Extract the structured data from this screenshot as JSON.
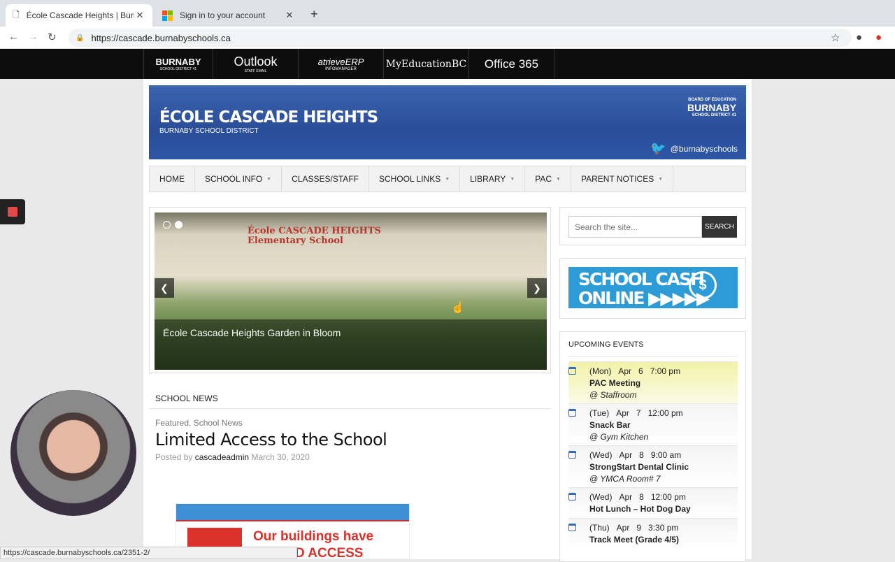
{
  "browser": {
    "tabs": [
      {
        "title": "École Cascade Heights | Burna",
        "active": true
      },
      {
        "title": "Sign in to your account",
        "active": false
      }
    ],
    "url": "https://cascade.burnabyschools.ca",
    "status_url": "https://cascade.burnabyschools.ca/2351-2/"
  },
  "toolbar": {
    "links": [
      {
        "label": "BURNABY",
        "sub": "SCHOOL DISTRICT 41"
      },
      {
        "label": "Outlook",
        "sub": "STAFF EMAIL"
      },
      {
        "label": "atrieveERP",
        "sub": "INFOMANAGER"
      },
      {
        "label": "MyEducationBC",
        "sub": ""
      },
      {
        "label": "Office 365",
        "sub": ""
      }
    ]
  },
  "banner": {
    "school": "ÉCOLE CASCADE HEIGHTS",
    "district": "BURNABY SCHOOL DISTRICT",
    "logo": "BURNABY",
    "logo_sub": "SCHOOL DISTRICT 41",
    "logo_top": "BOARD OF EDUCATION",
    "twitter": "@burnabyschools"
  },
  "nav": [
    "HOME",
    "SCHOOL INFO",
    "CLASSES/STAFF",
    "SCHOOL LINKS",
    "LIBRARY",
    "PAC",
    "PARENT NOTICES"
  ],
  "slider": {
    "caption": "École Cascade Heights Garden in Bloom",
    "sign_line1": "École CASCADE HEIGHTS",
    "sign_line2": "Elementary School"
  },
  "news": {
    "header": "SCHOOL NEWS",
    "categories": "Featured, School News",
    "title": "Limited Access to the School",
    "posted_by": "Posted by",
    "author": "cascadeadmin",
    "date": "March 30, 2020",
    "image_line1": "Our buildings have",
    "image_line2": "D ACCESS"
  },
  "search": {
    "placeholder": "Search the site...",
    "button": "SEARCH"
  },
  "cash": {
    "line1": "SCHOOL CASH",
    "line2": "ONLINE ▶▶▶▶▶"
  },
  "events": {
    "header": "UPCOMING EVENTS",
    "items": [
      {
        "day": "(Mon)",
        "month": "Apr",
        "date": "6",
        "time": "7:00 pm",
        "title": "PAC Meeting",
        "location": "@ Staffroom"
      },
      {
        "day": "(Tue)",
        "month": "Apr",
        "date": "7",
        "time": "12:00 pm",
        "title": "Snack Bar",
        "location": "@ Gym Kitchen"
      },
      {
        "day": "(Wed)",
        "month": "Apr",
        "date": "8",
        "time": "9:00 am",
        "title": "StrongStart Dental Clinic",
        "location": "@ YMCA Room# 7"
      },
      {
        "day": "(Wed)",
        "month": "Apr",
        "date": "8",
        "time": "12:00 pm",
        "title": "Hot Lunch – Hot Dog Day",
        "location": ""
      },
      {
        "day": "(Thu)",
        "month": "Apr",
        "date": "9",
        "time": "3:30 pm",
        "title": "Track Meet (Grade 4/5)",
        "location": ""
      }
    ]
  }
}
